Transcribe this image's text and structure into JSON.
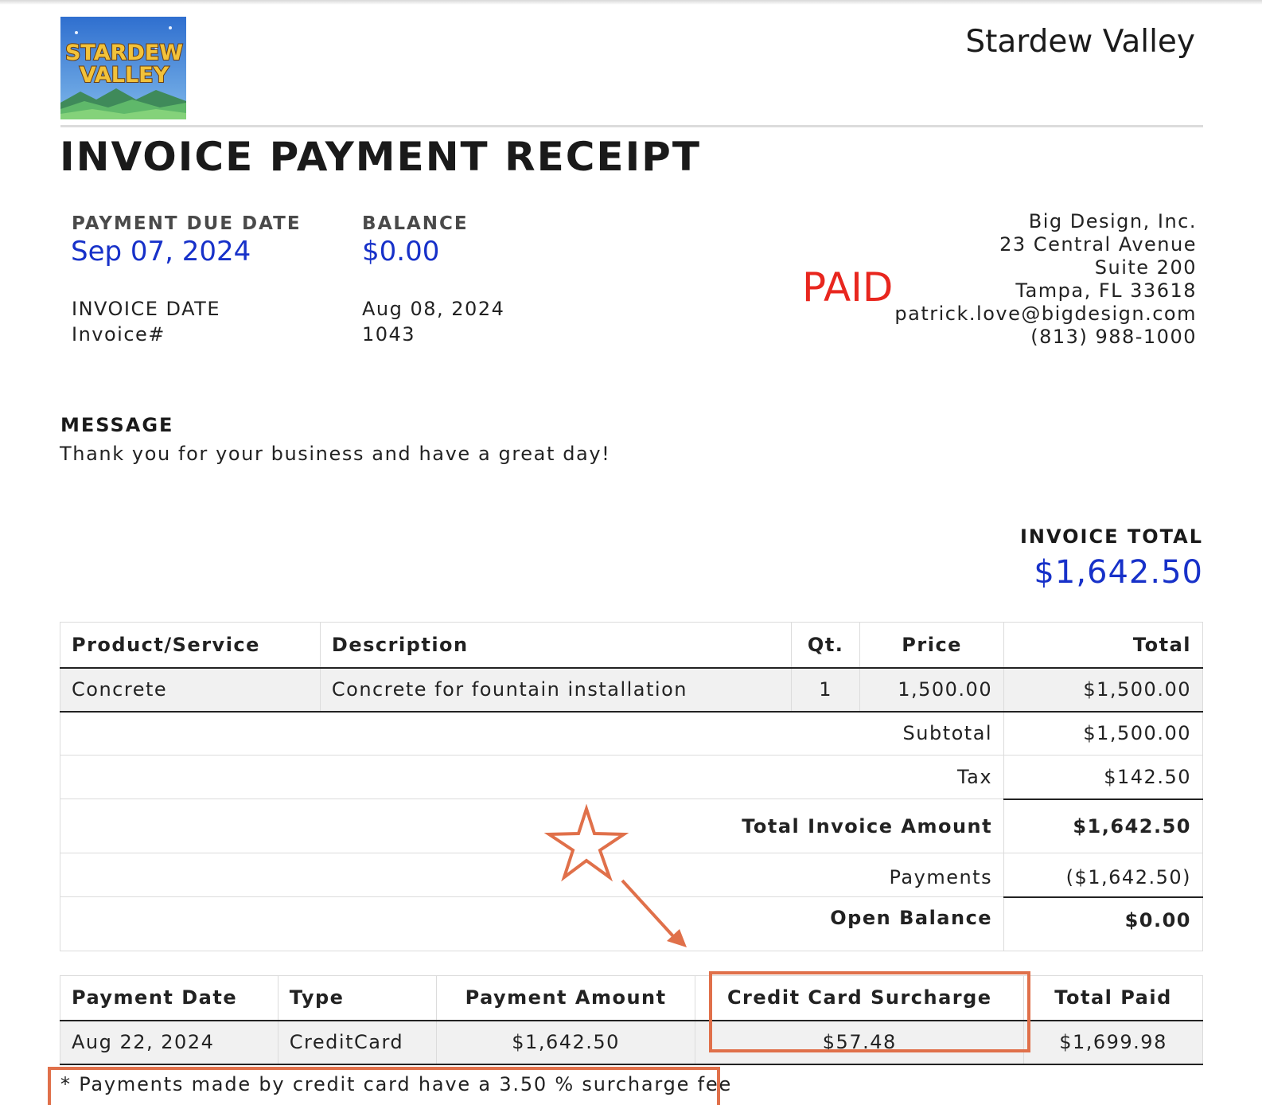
{
  "header": {
    "logo": {
      "text_line1": "STARDEW",
      "text_line2": "VALLEY",
      "icon": "stardew-valley-logo"
    },
    "brand_name": "Stardew Valley",
    "title": "INVOICE PAYMENT RECEIPT"
  },
  "meta": {
    "due_date_label": "PAYMENT DUE DATE",
    "due_date_value": "Sep 07, 2024",
    "balance_label": "BALANCE",
    "balance_value": "$0.00",
    "invoice_date_label": "INVOICE DATE",
    "invoice_date_value": "Aug 08, 2024",
    "invoice_no_label": "Invoice#",
    "invoice_no_value": "1043"
  },
  "status_stamp": "PAID",
  "company": {
    "name": "Big Design, Inc.",
    "address1": "23 Central Avenue",
    "address2": "Suite 200",
    "city": "Tampa, FL 33618",
    "email": "patrick.love@bigdesign.com",
    "phone": "(813) 988-1000"
  },
  "message": {
    "label": "MESSAGE",
    "body": "Thank you for your business and have a great day!"
  },
  "invoice_total": {
    "label": "INVOICE TOTAL",
    "value": "$1,642.50"
  },
  "items_table": {
    "headers": [
      "Product/Service",
      "Description",
      "Qt.",
      "Price",
      "Total"
    ],
    "rows": [
      {
        "product": "Concrete",
        "description": "Concrete for fountain installation",
        "qty": "1",
        "price": "1,500.00",
        "total": "$1,500.00"
      }
    ],
    "summary": {
      "subtotal_label": "Subtotal",
      "subtotal_value": "$1,500.00",
      "tax_label": "Tax",
      "tax_value": "$142.50",
      "total_label": "Total Invoice Amount",
      "total_value": "$1,642.50",
      "payments_label": "Payments",
      "payments_value": "($1,642.50)",
      "open_label": "Open Balance",
      "open_value": "$0.00"
    }
  },
  "payments_table": {
    "headers": [
      "Payment Date",
      "Type",
      "Payment Amount",
      "Credit Card Surcharge",
      "Total Paid"
    ],
    "rows": [
      {
        "date": "Aug 22, 2024",
        "type": "CreditCard",
        "amount": "$1,642.50",
        "surcharge": "$57.48",
        "total_paid": "$1,699.98"
      }
    ]
  },
  "footnote": "* Payments made by credit card have a 3.50 % surcharge fee",
  "colors": {
    "accent_blue": "#1731c9",
    "paid_red": "#e8261e",
    "annotation_orange": "#e0704a",
    "row_shade": "#f1f1f1"
  },
  "annotations": {
    "star_icon": "star-outline-icon",
    "arrow_icon": "arrow-down-right-icon"
  }
}
